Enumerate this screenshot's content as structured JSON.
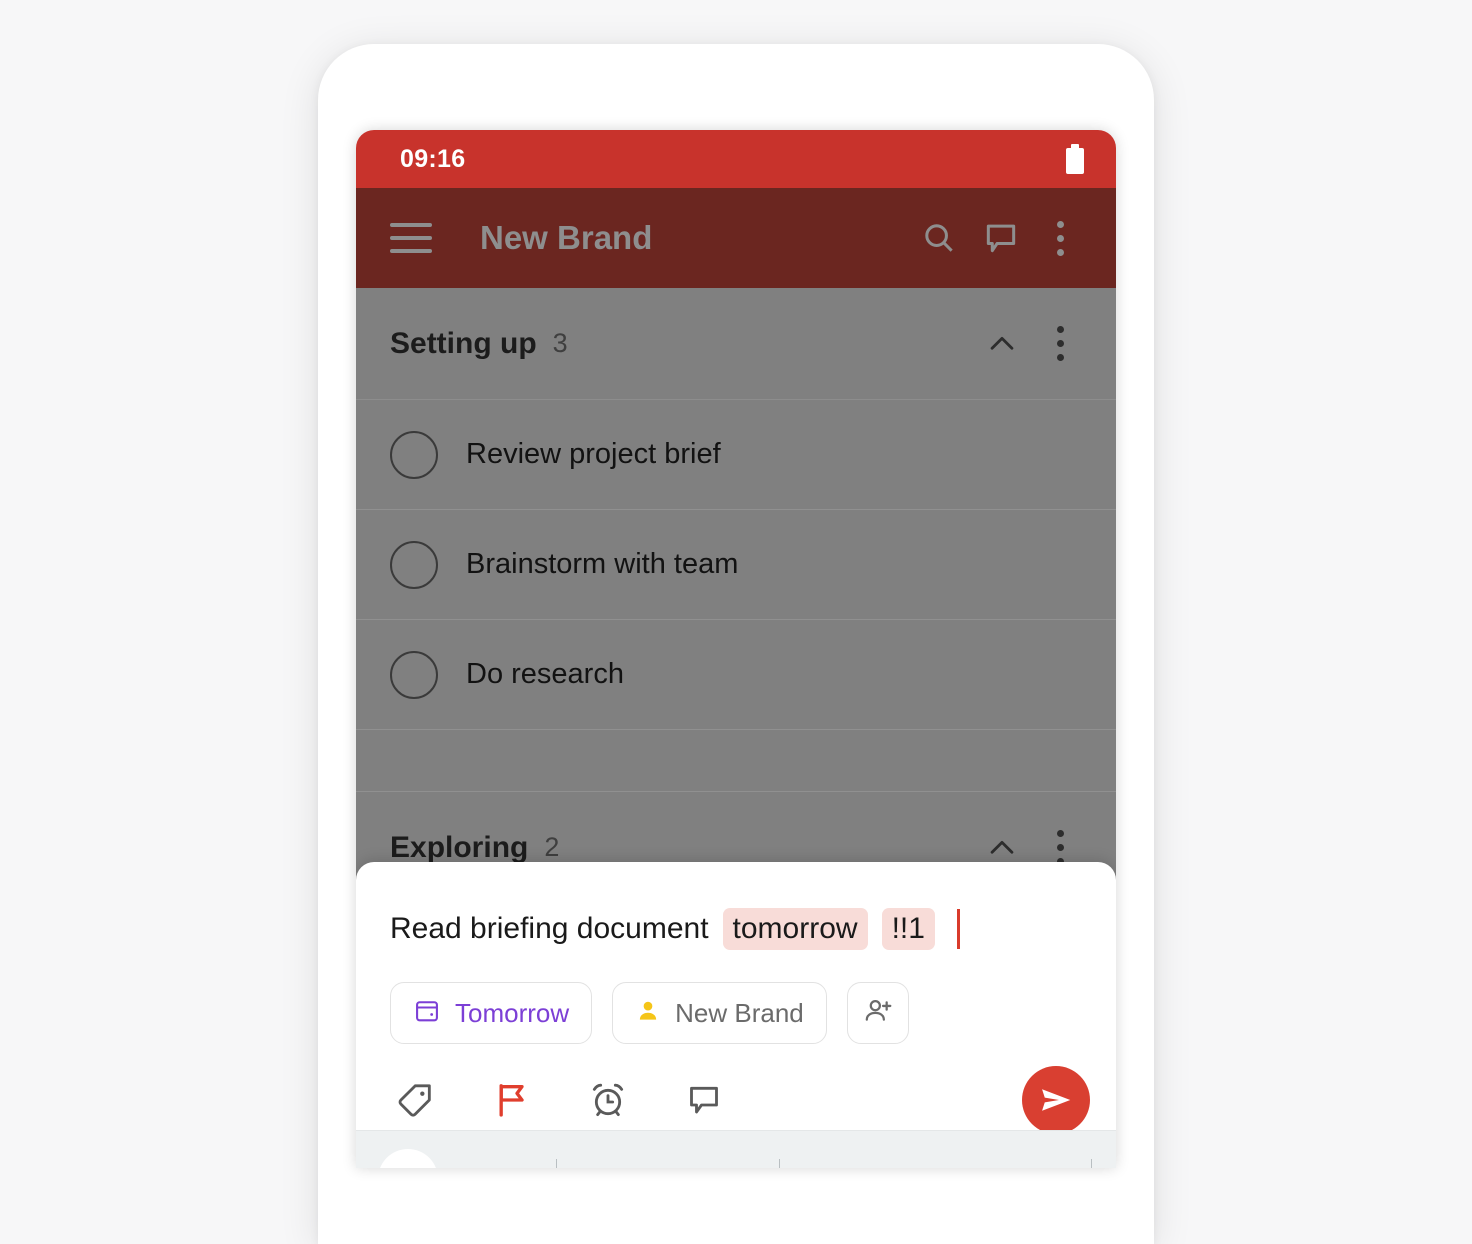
{
  "status_bar": {
    "time": "09:16",
    "battery_icon": "battery-full-icon",
    "background_color": "#c8332c"
  },
  "app_bar": {
    "menu_icon": "hamburger-menu-icon",
    "title": "New Brand",
    "search_icon": "search-icon",
    "comment_icon": "comment-icon",
    "overflow_icon": "more-vertical-icon",
    "background_color": "#6b2620"
  },
  "content": {
    "sections": [
      {
        "title": "Setting up",
        "count": "3",
        "collapse_icon": "chevron-up-icon",
        "overflow_icon": "more-vertical-icon",
        "tasks": [
          {
            "label": "Review project brief",
            "checkbox_icon": "circle-checkbox-icon"
          },
          {
            "label": "Brainstorm with team",
            "checkbox_icon": "circle-checkbox-icon"
          },
          {
            "label": "Do research",
            "checkbox_icon": "circle-checkbox-icon"
          }
        ]
      },
      {
        "title": "Exploring",
        "count": "2",
        "collapse_icon": "chevron-up-icon",
        "overflow_icon": "more-vertical-icon",
        "tasks": []
      }
    ]
  },
  "quick_add": {
    "text_plain": "Read briefing document",
    "token_date": "tomorrow",
    "token_priority": "!!1",
    "caret_color": "#d93b2b",
    "token_background": "#f8dcd8",
    "chips": [
      {
        "name": "date-chip",
        "label": "Tomorrow",
        "icon": "calendar-icon",
        "icon_color": "#7c3fd6",
        "text_color": "#7c3fd6"
      },
      {
        "name": "project-chip",
        "label": "New Brand",
        "icon": "person-icon",
        "icon_color": "#f5c518",
        "text_color": "#6b6b6b"
      },
      {
        "name": "assign-chip",
        "label": "",
        "icon": "person-add-icon",
        "icon_color": "#6b6b6b",
        "text_color": "#6b6b6b"
      }
    ],
    "toolbar": [
      {
        "name": "label-button",
        "icon": "tag-icon",
        "color": "#5a5a5a",
        "active": false
      },
      {
        "name": "priority-button",
        "icon": "flag-icon",
        "color": "#e03e2d",
        "active": true
      },
      {
        "name": "reminder-button",
        "icon": "alarm-clock-icon",
        "color": "#5a5a5a",
        "active": false
      },
      {
        "name": "comment-button",
        "icon": "comment-icon",
        "color": "#5a5a5a",
        "active": false
      }
    ],
    "send": {
      "icon": "send-icon",
      "background": "#d93f31"
    }
  },
  "keyboard": {
    "suggestion_icon": "emoji-suggestion-icon"
  }
}
